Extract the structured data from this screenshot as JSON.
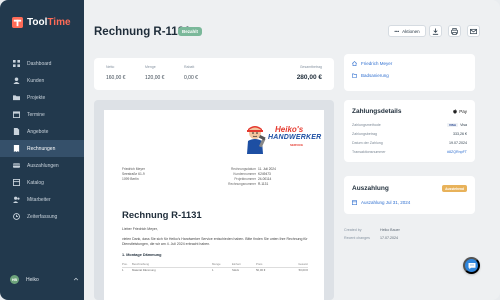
{
  "app": {
    "brand_part1": "Tool",
    "brand_part2": "Time"
  },
  "sidebar": {
    "items": [
      {
        "label": "Dashboard",
        "icon": "dashboard-icon"
      },
      {
        "label": "Kunden",
        "icon": "users-icon"
      },
      {
        "label": "Projekte",
        "icon": "folder-icon"
      },
      {
        "label": "Termine",
        "icon": "calendar-icon"
      },
      {
        "label": "Angebote",
        "icon": "document-icon"
      },
      {
        "label": "Rechnungen",
        "icon": "invoice-icon",
        "active": true
      },
      {
        "label": "Auszahlungen",
        "icon": "payout-icon"
      },
      {
        "label": "Katalog",
        "icon": "catalog-icon"
      },
      {
        "label": "Mitarbeiter",
        "icon": "employee-icon"
      },
      {
        "label": "Zeiterfassung",
        "icon": "clock-icon"
      }
    ],
    "user": {
      "initials": "HB",
      "name": "Heiko"
    }
  },
  "header": {
    "title": "Rechnung R-1131",
    "status": "Bezahlt",
    "actions_label": "Aktionen"
  },
  "summary": {
    "net_label": "Netto",
    "net_value": "160,00 €",
    "amount_label": "Menge",
    "amount_value": "120,00 €",
    "tax_label": "Rabatt",
    "tax_value": "0,00 €",
    "total_label": "Gesamtbetrag",
    "total_value": "280,00 €"
  },
  "document": {
    "brand_line1": "Heiko's",
    "brand_line2": "HANDWERKER",
    "brand_line3": "SERVICE",
    "address": [
      "Friedrich Meyer",
      "Seestraße 61-9",
      "1099 Berlin"
    ],
    "meta": [
      {
        "k": "Rechnungsdatum",
        "v": "11. Juli 2024"
      },
      {
        "k": "Kundennummer",
        "v": "K249473"
      },
      {
        "k": "Projektnummer",
        "v": "24-00114"
      },
      {
        "k": "Rechnungsnummer",
        "v": "R-1131"
      }
    ],
    "title": "Rechnung R-1131",
    "greeting": "Lieber Friedrich Meyer,",
    "intro": "vielen Dank, dass Sie sich für Heiko's Handwerker Service entschieden haben. Bitte finden Sie unten Ihre Rechnung für Dienstleistungen, die wir am 4. Juli 2024 erbracht haben.",
    "section_title": "1. Montage Dämmung",
    "items_head": [
      "Pos.",
      "Beschreibung",
      "Menge",
      "Einheit",
      "Preis",
      "Gesamt"
    ],
    "items_row": [
      "1",
      "Material Dämmung",
      "1",
      "Stück",
      "50,00 €",
      "50,00 €"
    ]
  },
  "customer": {
    "name": "Friedrich Meyer",
    "project": "Badsanierung"
  },
  "payment": {
    "title": "Zahlungsdetails",
    "provider": "Pay",
    "rows": [
      {
        "k": "Zahlungsmethode",
        "v": "Visa"
      },
      {
        "k": "Zahlungsbetrag",
        "v": "333,26 €"
      },
      {
        "k": "Datum der Zahlung",
        "v": "19.07.2024"
      },
      {
        "k": "Transaktionsnummer",
        "v": "#8ZQRnpFT"
      }
    ],
    "visa_badge": "VISA"
  },
  "payout": {
    "title": "Auszahlung",
    "status": "Ausstehend",
    "link": "Auszahlung Jul 31, 2024"
  },
  "audit": {
    "rows": [
      {
        "k": "Created by",
        "v": "Heiko Bauer"
      },
      {
        "k": "Recent changes",
        "v": "17.07.2024"
      }
    ]
  },
  "colors": {
    "sidebar": "#22394d",
    "accent": "#2f6fd0",
    "paid": "#7ab89a",
    "pending": "#e8b25a",
    "brand_red": "#ff6b57"
  }
}
